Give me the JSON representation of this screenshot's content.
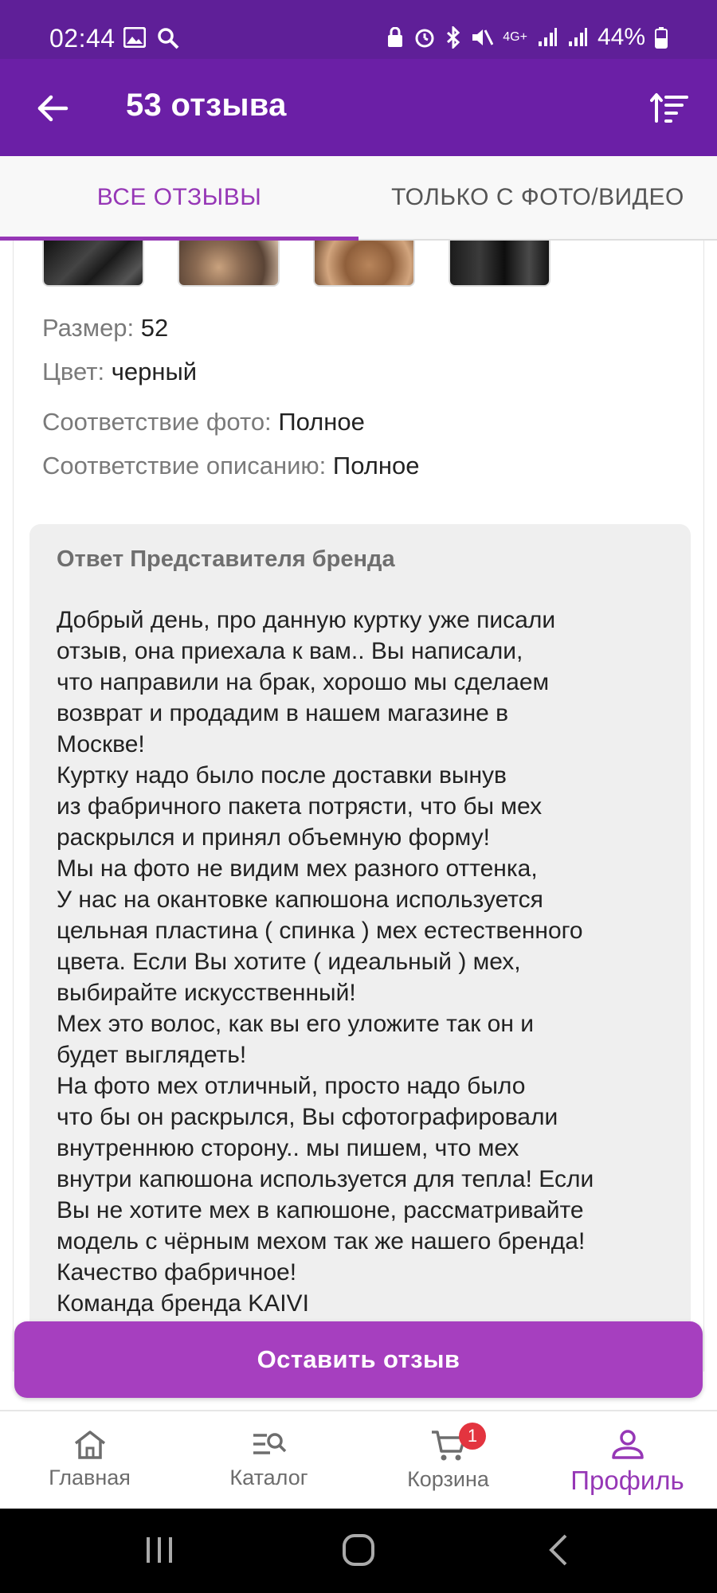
{
  "status_bar": {
    "time": "02:44",
    "network": "4G+",
    "battery": "44%"
  },
  "header": {
    "title": "53 отзыва"
  },
  "tabs": [
    {
      "label": "ВСЕ ОТЗЫВЫ",
      "active": true
    },
    {
      "label": "ТОЛЬКО С ФОТО/ВИДЕО",
      "active": false
    }
  ],
  "review": {
    "size_label": "Размер:",
    "size_value": "52",
    "color_label": "Цвет:",
    "color_value": "черный",
    "photo_match_label": "Соответствие фото:",
    "photo_match_value": "Полное",
    "desc_match_label": "Соответствие описанию:",
    "desc_match_value": "Полное"
  },
  "brand_reply": {
    "title": "Ответ Представителя бренда",
    "text": "Добрый день, про данную куртку уже писали\nотзыв, она приехала к вам.. Вы написали,\nчто направили на брак, хорошо мы сделаем\nвозврат и продадим в нашем магазине в\nМоскве!\nКуртку надо было после доставки вынув\nиз фабричного пакета потрясти, что бы мех\nраскрылся и принял объемную форму!\nМы на фото не видим мех разного оттенка,\nУ нас на окантовке капюшона используется\nцельная пластина ( спинка ) мех естественного\nцвета. Если Вы хотите ( идеальный ) мех,\nвыбирайте искусственный!\nМех это волос, как вы его уложите так он и\nбудет выглядеть!\nНа фото мех отличный, просто надо было\nчто бы он раскрылся, Вы сфотографировали\nвнутреннюю сторону.. мы пишем, что мех\nвнутри капюшона используется для тепла! Если\nВы не хотите мех в капюшоне, рассматривайте\nмодель с чёрным мехом так же нашего бренда!\nКачество фабричное!\nКоманда бренда KAIVI"
  },
  "actions": {
    "leave_review": "Оставить отзыв"
  },
  "bottom_nav": {
    "items": [
      {
        "label": "Главная",
        "icon": "home-icon"
      },
      {
        "label": "Каталог",
        "icon": "catalog-icon"
      },
      {
        "label": "Корзина",
        "icon": "cart-icon",
        "badge": "1"
      },
      {
        "label": "Профиль",
        "icon": "profile-icon",
        "active": true
      }
    ]
  },
  "colors": {
    "app_bar": "#6b1fa6",
    "accent": "#9637b6",
    "button": "#a63fbf",
    "badge": "#e3343f"
  }
}
